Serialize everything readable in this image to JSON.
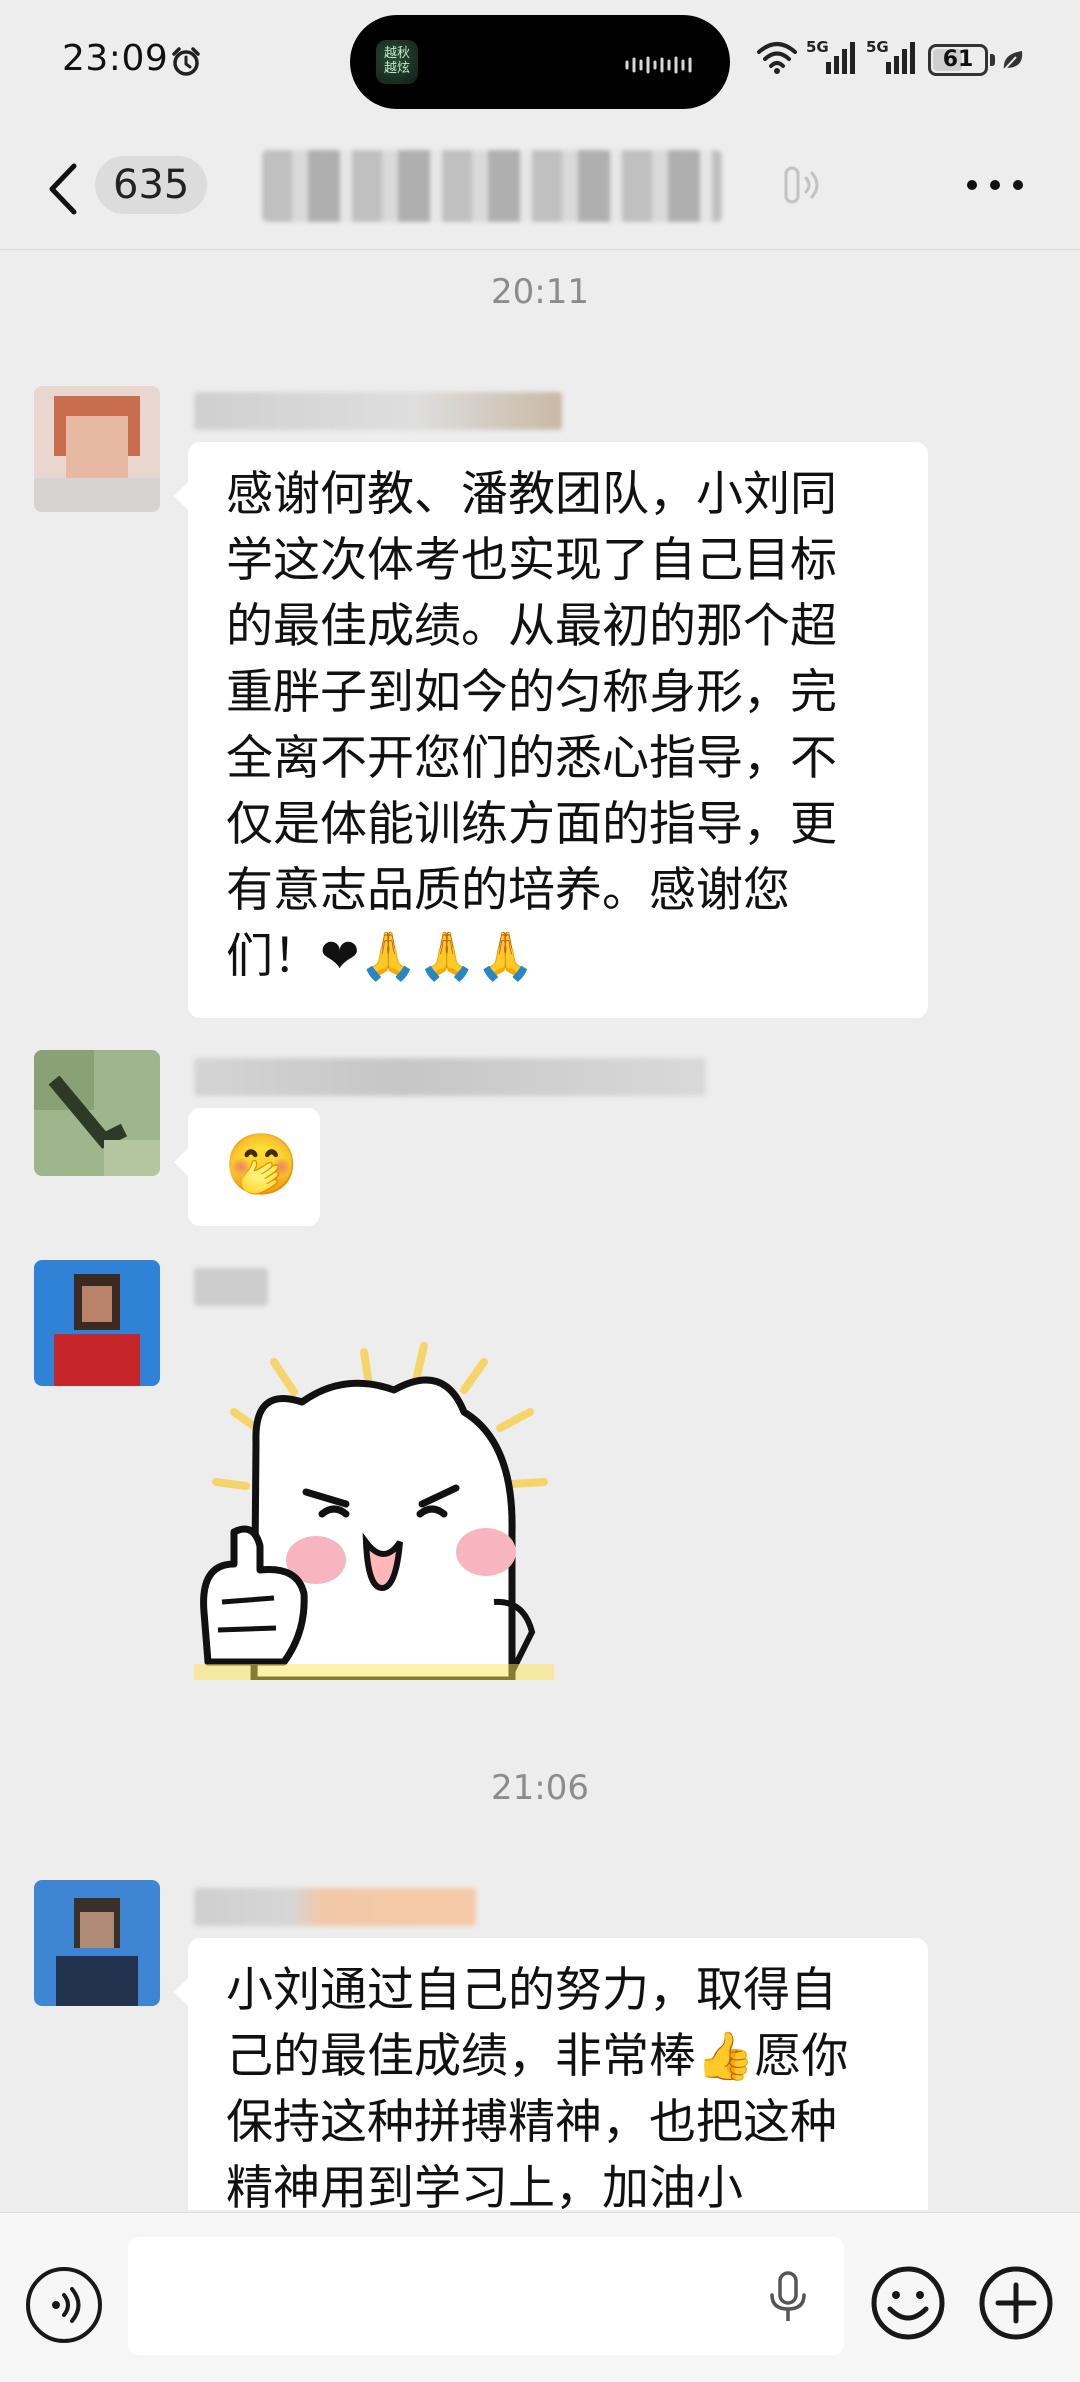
{
  "status_bar": {
    "time": "23:09",
    "island_app_label": "越秋\n越炫",
    "signal_1_label": "5G",
    "signal_2_label": "5G",
    "battery_level": "61",
    "battery_fraction": 0.61
  },
  "header": {
    "unread_count": "635",
    "group_title": "",
    "icons": [
      "back-chevron-icon",
      "voice-mode-icon",
      "more-icon"
    ]
  },
  "chat": {
    "timestamps": [
      "20:11",
      "21:06"
    ],
    "messages": [
      {
        "sender": "",
        "text": "感谢何教、潘教团队，小刘同\n学这次体考也实现了自己目标\n的最佳成绩。从最初的那个超\n重胖子到如今的匀称身形，完\n全离不开您们的悉心指导，不\n仅是体能训练方面的指导，更\n有意志品质的培养。感谢您\n们！❤🙏🙏🙏"
      },
      {
        "sender": "",
        "text": "🤭"
      },
      {
        "sender": "",
        "sticker": "thumbs-up-cat-sticker"
      },
      {
        "sender": "",
        "text": "小刘通过自己的努力，取得自\n己的最佳成绩，非常棒👍愿你\n保持这种拼搏精神，也把这种\n精神用到学习上，加油小"
      }
    ]
  },
  "input_bar": {
    "message_value": "",
    "message_placeholder": "",
    "icons": [
      "voice-toggle-icon",
      "microphone-icon",
      "emoji-icon",
      "plus-icon"
    ]
  },
  "colors": {
    "background": "#ededed",
    "bubble": "#ffffff",
    "timestamp": "#8c8c8c",
    "heart": "#e8455d",
    "pray": "#f4b63a"
  }
}
